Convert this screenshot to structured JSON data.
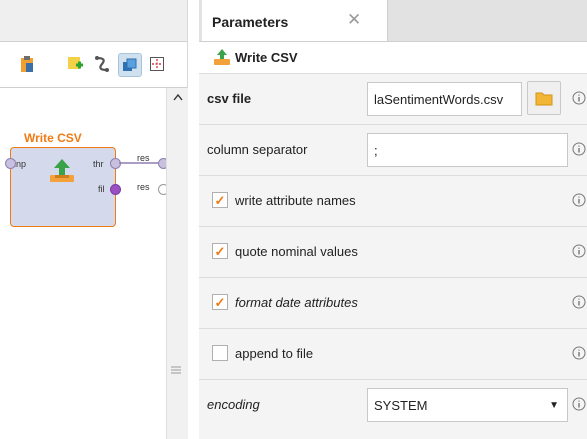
{
  "canvas": {
    "operator": {
      "title": "Write CSV",
      "ports_in": [
        "inp"
      ],
      "ports_out": [
        "thr",
        "fil"
      ]
    },
    "result_ports": [
      "res",
      "res"
    ],
    "toolbar_icons": [
      "clipboard-icon",
      "add-note-icon",
      "auto-wire-icon",
      "layers-icon",
      "fit-view-icon"
    ]
  },
  "parameters_panel": {
    "tab_label": "Parameters",
    "tab_close": "✕",
    "operator_name": "Write CSV",
    "rows": {
      "csv_file": {
        "label": "csv file",
        "value": "laSentimentWords.csv"
      },
      "column_separator": {
        "label": "column separator",
        "value": ";"
      },
      "write_attribute_names": {
        "label": "write attribute names",
        "checked": true
      },
      "quote_nominal_values": {
        "label": "quote nominal values",
        "checked": true
      },
      "format_date_attributes": {
        "label": "format date attributes",
        "checked": true
      },
      "append_to_file": {
        "label": "append to file",
        "checked": false
      },
      "encoding": {
        "label": "encoding",
        "value": "SYSTEM"
      }
    },
    "check_mark": "✓"
  },
  "colors": {
    "accent_orange": "#f07a12",
    "operator_fill": "#d5d9ec",
    "port_purple": "#9a4fc2"
  }
}
